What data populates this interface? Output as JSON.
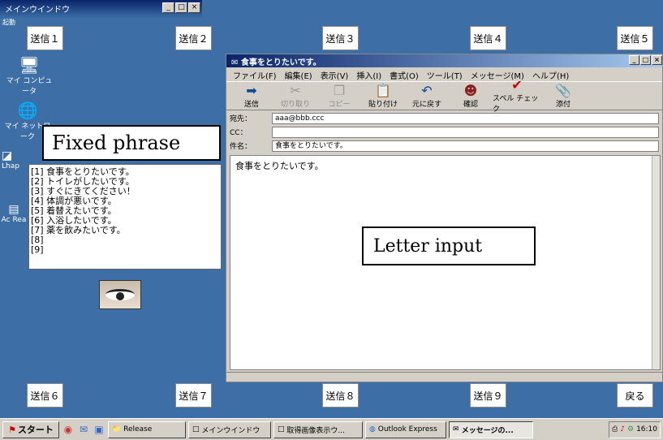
{
  "main_window": {
    "title": "メインウインドウ",
    "subtitle": "起動"
  },
  "send_buttons": {
    "b1": "送信１",
    "b2": "送信２",
    "b3": "送信３",
    "b4": "送信４",
    "b5": "送信５",
    "b6": "送信６",
    "b7": "送信７",
    "b8": "送信８",
    "b9": "送信９",
    "back": "戻る"
  },
  "desktop_icons": [
    {
      "label": "マイ コンピュータ",
      "icon": "computer-icon"
    },
    {
      "label": "マイ ネットワーク",
      "icon": "network-icon"
    },
    {
      "label": "Lhap",
      "icon": "app-icon"
    },
    {
      "label": "Ac Rea",
      "icon": "acrobat-icon"
    }
  ],
  "fixed_phrase": {
    "label": "Fixed phrase",
    "items": [
      "[1] 食事をとりたいです。",
      "[2] トイレがしたいです。",
      "[3] すぐにきてください！",
      "[4] 体調が悪いです。",
      "[5] 着替えたいです。",
      "[6] 入浴したいです。",
      "[7] 薬を飲みたいです。",
      "[8]",
      "[9]"
    ]
  },
  "message_window": {
    "title": "食事をとりたいです。",
    "menu": [
      "ファイル(F)",
      "編集(E)",
      "表示(V)",
      "挿入(I)",
      "書式(O)",
      "ツール(T)",
      "メッセージ(M)",
      "ヘルプ(H)"
    ],
    "toolbar": {
      "send": "送信",
      "cut": "切り取り",
      "copy": "コピー",
      "paste": "貼り付け",
      "undo": "元に戻す",
      "check": "確認",
      "spell": "スペル チェック",
      "attach": "添付"
    },
    "to_label": "宛先：",
    "to_value": "aaa@bbb.ccc",
    "cc_label": "CC：",
    "cc_value": "",
    "subject_label": "件名：",
    "subject_value": "食事をとりたいです。",
    "body": "食事をとりたいです。",
    "letter_input_label": "Letter input"
  },
  "taskbar": {
    "start": "スタート",
    "tasks": [
      "Release",
      "メインウインドウ",
      "取得画像表示ウ...",
      "Outlook Express",
      "メッセージの..."
    ],
    "clock": "16:10"
  },
  "colors": {
    "desktop": "#3d6ea6",
    "title_bar": "#0a246a"
  }
}
